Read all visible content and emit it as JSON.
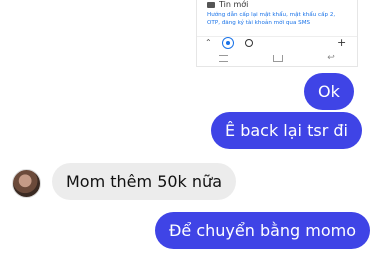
{
  "screenshot": {
    "header": "Tin mới",
    "text": "Hướng dẫn cấp lại mật khẩu, mật khẩu cấp 2, OTP, đăng ký tài khoản mới qua SMS"
  },
  "messages": {
    "out_1": "Ok",
    "out_2": "Ê back lại tsr đi",
    "in_1": "Mom thêm 50k nữa",
    "out_3": "Để chuyển bằng momo"
  },
  "colors": {
    "outgoing_bubble": "#3f44e6",
    "incoming_bubble": "#ececec"
  }
}
